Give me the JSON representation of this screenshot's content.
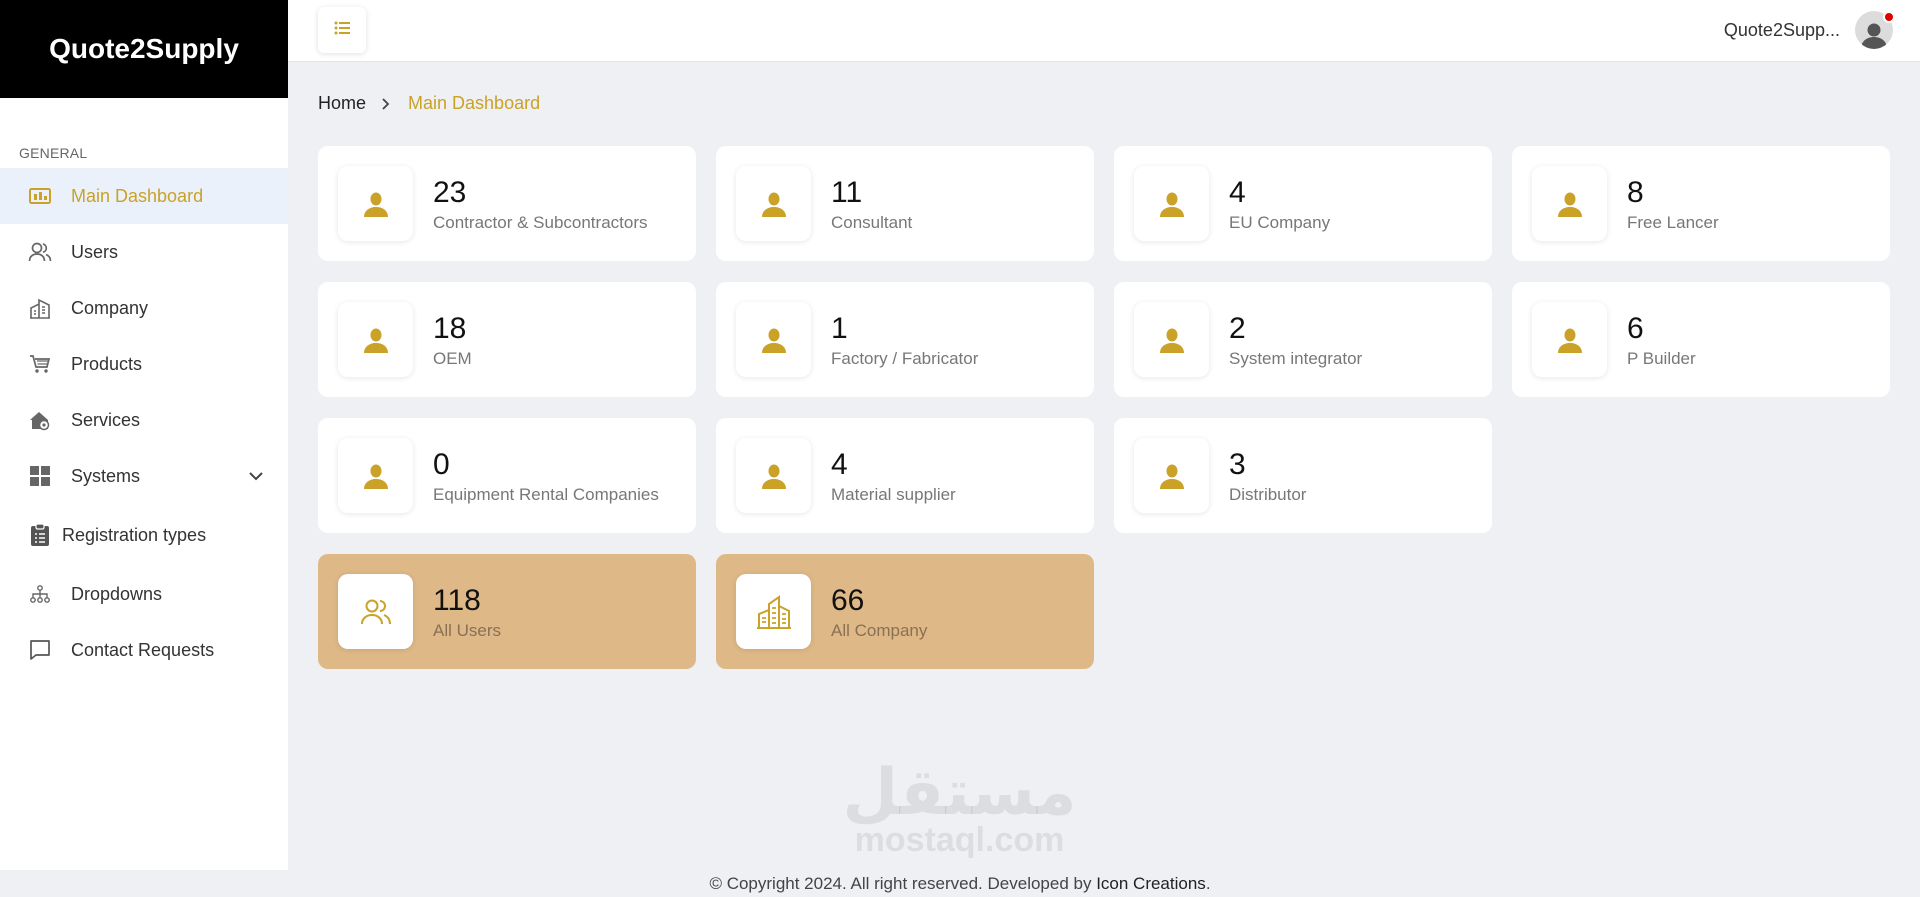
{
  "brand": {
    "title": "Quote2Supply"
  },
  "sidebar": {
    "section_label": "GENERAL",
    "items": [
      {
        "label": "Main Dashboard",
        "icon": "dashboard-icon",
        "active": true
      },
      {
        "label": "Users",
        "icon": "users-icon"
      },
      {
        "label": "Company",
        "icon": "company-icon"
      },
      {
        "label": "Products",
        "icon": "cart-icon"
      },
      {
        "label": "Services",
        "icon": "services-icon"
      },
      {
        "label": "Systems",
        "icon": "grid-icon",
        "has_submenu": true
      },
      {
        "label": "Registration types",
        "icon": "clipboard-icon"
      },
      {
        "label": "Dropdowns",
        "icon": "hierarchy-icon"
      },
      {
        "label": "Contact Requests",
        "icon": "chat-icon"
      }
    ]
  },
  "topbar": {
    "menu_icon": "list-icon",
    "user_name": "Quote2Supp...",
    "notification_color": "#e00000"
  },
  "breadcrumb": {
    "home": "Home",
    "current": "Main Dashboard"
  },
  "accent_color": "#c9a227",
  "cards": [
    {
      "count": "23",
      "label": "Contractor & Subcontractors"
    },
    {
      "count": "11",
      "label": "Consultant"
    },
    {
      "count": "4",
      "label": "EU Company"
    },
    {
      "count": "8",
      "label": "Free Lancer"
    },
    {
      "count": "18",
      "label": "OEM"
    },
    {
      "count": "1",
      "label": "Factory / Fabricator"
    },
    {
      "count": "2",
      "label": "System integrator"
    },
    {
      "count": "6",
      "label": "P Builder"
    },
    {
      "count": "0",
      "label": "Equipment Rental Companies"
    },
    {
      "count": "4",
      "label": "Material supplier"
    },
    {
      "count": "3",
      "label": "Distributor"
    }
  ],
  "totals": [
    {
      "count": "118",
      "label": "All Users",
      "icon": "users-icon"
    },
    {
      "count": "66",
      "label": "All Company",
      "icon": "building-icon"
    }
  ],
  "watermark": {
    "arabic": "مستقل",
    "latin": "mostaql.com"
  },
  "footer": {
    "text": "© Copyright 2024. All right reserved. Developed by ",
    "developer": "Icon Creations",
    "suffix": "."
  }
}
